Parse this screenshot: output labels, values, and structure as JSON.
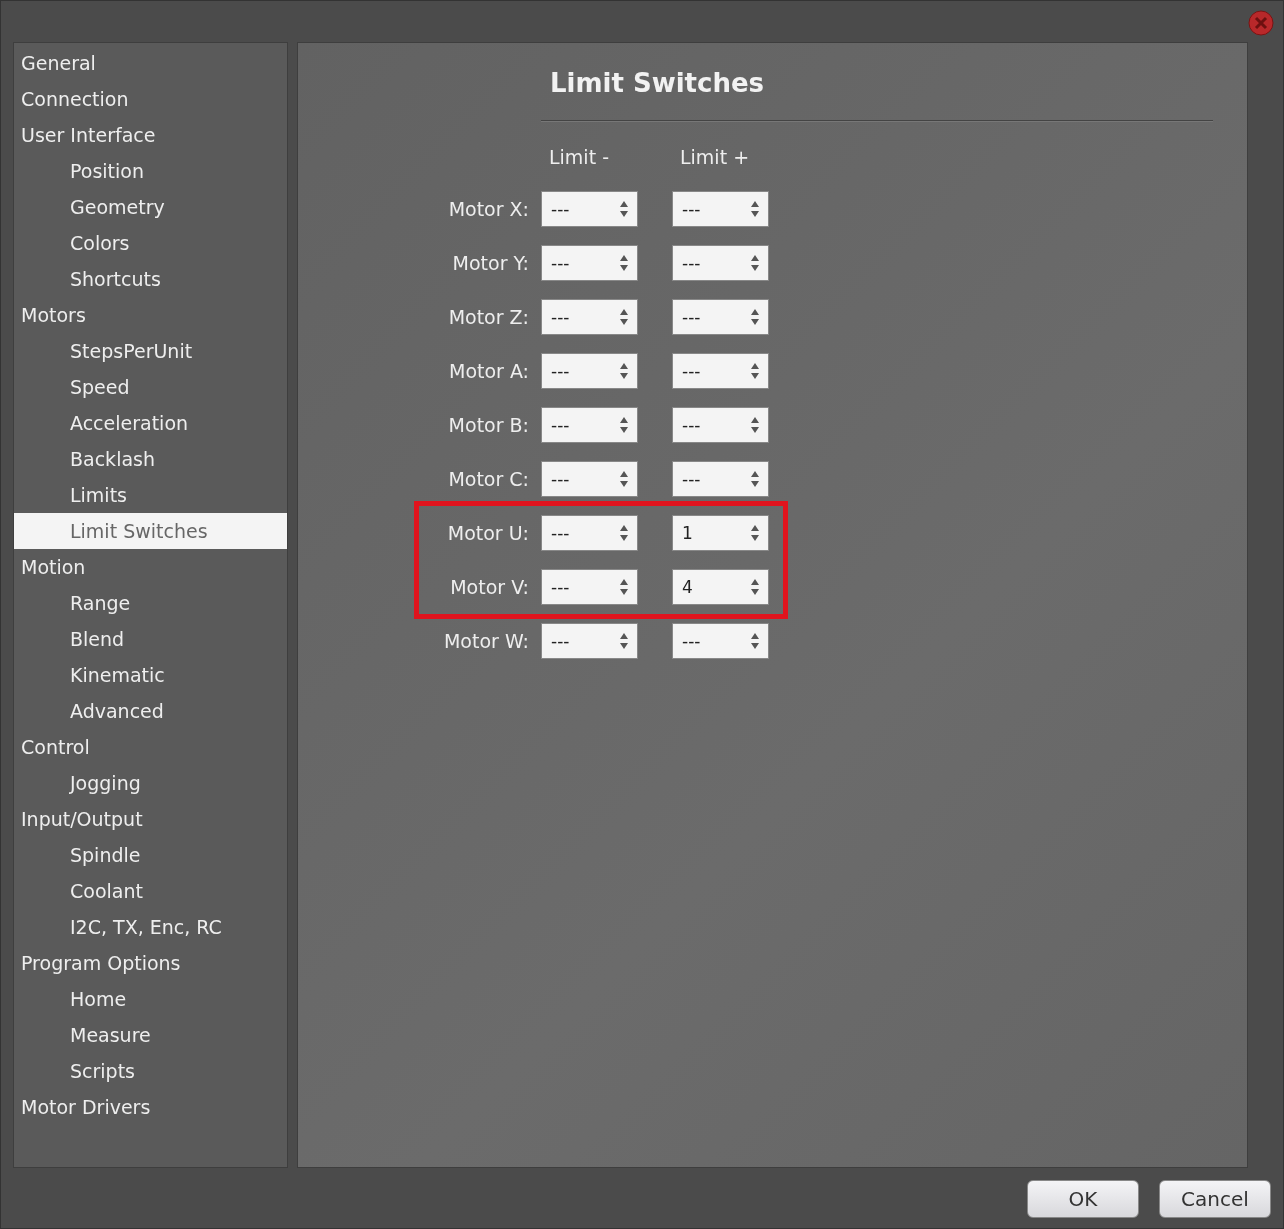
{
  "sidebar": {
    "items": [
      {
        "label": "General",
        "selected": false
      },
      {
        "label": "Connection",
        "selected": false
      },
      {
        "label": "User Interface",
        "selected": false,
        "children": [
          {
            "label": "Position",
            "selected": false
          },
          {
            "label": "Geometry",
            "selected": false
          },
          {
            "label": "Colors",
            "selected": false
          },
          {
            "label": "Shortcuts",
            "selected": false
          }
        ]
      },
      {
        "label": "Motors",
        "selected": false,
        "children": [
          {
            "label": "StepsPerUnit",
            "selected": false
          },
          {
            "label": "Speed",
            "selected": false
          },
          {
            "label": "Acceleration",
            "selected": false
          },
          {
            "label": "Backlash",
            "selected": false
          },
          {
            "label": "Limits",
            "selected": false
          },
          {
            "label": "Limit Switches",
            "selected": true
          }
        ]
      },
      {
        "label": "Motion",
        "selected": false,
        "children": [
          {
            "label": "Range",
            "selected": false
          },
          {
            "label": "Blend",
            "selected": false
          },
          {
            "label": "Kinematic",
            "selected": false
          },
          {
            "label": "Advanced",
            "selected": false
          }
        ]
      },
      {
        "label": "Control",
        "selected": false,
        "children": [
          {
            "label": "Jogging",
            "selected": false
          }
        ]
      },
      {
        "label": "Input/Output",
        "selected": false,
        "children": [
          {
            "label": "Spindle",
            "selected": false
          },
          {
            "label": "Coolant",
            "selected": false
          },
          {
            "label": "I2C, TX, Enc, RC",
            "selected": false
          }
        ]
      },
      {
        "label": "Program Options",
        "selected": false,
        "children": [
          {
            "label": "Home",
            "selected": false
          },
          {
            "label": "Measure",
            "selected": false
          },
          {
            "label": "Scripts",
            "selected": false
          }
        ]
      },
      {
        "label": "Motor Drivers",
        "selected": false
      }
    ]
  },
  "panel": {
    "title": "Limit Switches",
    "columns": [
      "Limit -",
      "Limit +"
    ],
    "rows": [
      {
        "label": "Motor X:",
        "limit_minus": "---",
        "limit_plus": "---",
        "highlighted": false
      },
      {
        "label": "Motor Y:",
        "limit_minus": "---",
        "limit_plus": "---",
        "highlighted": false
      },
      {
        "label": "Motor Z:",
        "limit_minus": "---",
        "limit_plus": "---",
        "highlighted": false
      },
      {
        "label": "Motor A:",
        "limit_minus": "---",
        "limit_plus": "---",
        "highlighted": false
      },
      {
        "label": "Motor B:",
        "limit_minus": "---",
        "limit_plus": "---",
        "highlighted": false
      },
      {
        "label": "Motor C:",
        "limit_minus": "---",
        "limit_plus": "---",
        "highlighted": false
      },
      {
        "label": "Motor U:",
        "limit_minus": "---",
        "limit_plus": "1",
        "highlighted": true
      },
      {
        "label": "Motor V:",
        "limit_minus": "---",
        "limit_plus": "4",
        "highlighted": true
      },
      {
        "label": "Motor W:",
        "limit_minus": "---",
        "limit_plus": "---",
        "highlighted": false
      }
    ]
  },
  "buttons": [
    "OK",
    "Cancel"
  ]
}
